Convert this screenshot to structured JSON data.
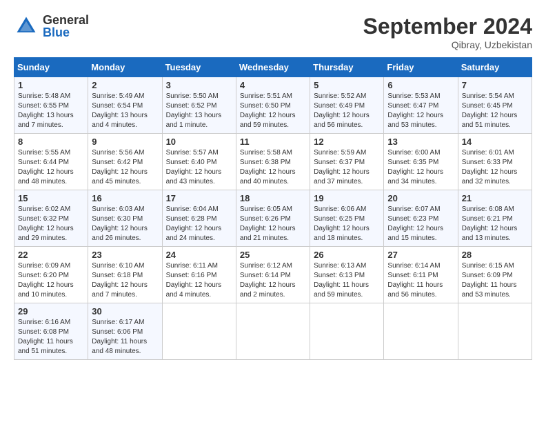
{
  "header": {
    "logo_general": "General",
    "logo_blue": "Blue",
    "month_title": "September 2024",
    "location": "Qibray, Uzbekistan"
  },
  "days_of_week": [
    "Sunday",
    "Monday",
    "Tuesday",
    "Wednesday",
    "Thursday",
    "Friday",
    "Saturday"
  ],
  "weeks": [
    [
      {
        "day": "1",
        "info": "Sunrise: 5:48 AM\nSunset: 6:55 PM\nDaylight: 13 hours\nand 7 minutes."
      },
      {
        "day": "2",
        "info": "Sunrise: 5:49 AM\nSunset: 6:54 PM\nDaylight: 13 hours\nand 4 minutes."
      },
      {
        "day": "3",
        "info": "Sunrise: 5:50 AM\nSunset: 6:52 PM\nDaylight: 13 hours\nand 1 minute."
      },
      {
        "day": "4",
        "info": "Sunrise: 5:51 AM\nSunset: 6:50 PM\nDaylight: 12 hours\nand 59 minutes."
      },
      {
        "day": "5",
        "info": "Sunrise: 5:52 AM\nSunset: 6:49 PM\nDaylight: 12 hours\nand 56 minutes."
      },
      {
        "day": "6",
        "info": "Sunrise: 5:53 AM\nSunset: 6:47 PM\nDaylight: 12 hours\nand 53 minutes."
      },
      {
        "day": "7",
        "info": "Sunrise: 5:54 AM\nSunset: 6:45 PM\nDaylight: 12 hours\nand 51 minutes."
      }
    ],
    [
      {
        "day": "8",
        "info": "Sunrise: 5:55 AM\nSunset: 6:44 PM\nDaylight: 12 hours\nand 48 minutes."
      },
      {
        "day": "9",
        "info": "Sunrise: 5:56 AM\nSunset: 6:42 PM\nDaylight: 12 hours\nand 45 minutes."
      },
      {
        "day": "10",
        "info": "Sunrise: 5:57 AM\nSunset: 6:40 PM\nDaylight: 12 hours\nand 43 minutes."
      },
      {
        "day": "11",
        "info": "Sunrise: 5:58 AM\nSunset: 6:38 PM\nDaylight: 12 hours\nand 40 minutes."
      },
      {
        "day": "12",
        "info": "Sunrise: 5:59 AM\nSunset: 6:37 PM\nDaylight: 12 hours\nand 37 minutes."
      },
      {
        "day": "13",
        "info": "Sunrise: 6:00 AM\nSunset: 6:35 PM\nDaylight: 12 hours\nand 34 minutes."
      },
      {
        "day": "14",
        "info": "Sunrise: 6:01 AM\nSunset: 6:33 PM\nDaylight: 12 hours\nand 32 minutes."
      }
    ],
    [
      {
        "day": "15",
        "info": "Sunrise: 6:02 AM\nSunset: 6:32 PM\nDaylight: 12 hours\nand 29 minutes."
      },
      {
        "day": "16",
        "info": "Sunrise: 6:03 AM\nSunset: 6:30 PM\nDaylight: 12 hours\nand 26 minutes."
      },
      {
        "day": "17",
        "info": "Sunrise: 6:04 AM\nSunset: 6:28 PM\nDaylight: 12 hours\nand 24 minutes."
      },
      {
        "day": "18",
        "info": "Sunrise: 6:05 AM\nSunset: 6:26 PM\nDaylight: 12 hours\nand 21 minutes."
      },
      {
        "day": "19",
        "info": "Sunrise: 6:06 AM\nSunset: 6:25 PM\nDaylight: 12 hours\nand 18 minutes."
      },
      {
        "day": "20",
        "info": "Sunrise: 6:07 AM\nSunset: 6:23 PM\nDaylight: 12 hours\nand 15 minutes."
      },
      {
        "day": "21",
        "info": "Sunrise: 6:08 AM\nSunset: 6:21 PM\nDaylight: 12 hours\nand 13 minutes."
      }
    ],
    [
      {
        "day": "22",
        "info": "Sunrise: 6:09 AM\nSunset: 6:20 PM\nDaylight: 12 hours\nand 10 minutes."
      },
      {
        "day": "23",
        "info": "Sunrise: 6:10 AM\nSunset: 6:18 PM\nDaylight: 12 hours\nand 7 minutes."
      },
      {
        "day": "24",
        "info": "Sunrise: 6:11 AM\nSunset: 6:16 PM\nDaylight: 12 hours\nand 4 minutes."
      },
      {
        "day": "25",
        "info": "Sunrise: 6:12 AM\nSunset: 6:14 PM\nDaylight: 12 hours\nand 2 minutes."
      },
      {
        "day": "26",
        "info": "Sunrise: 6:13 AM\nSunset: 6:13 PM\nDaylight: 11 hours\nand 59 minutes."
      },
      {
        "day": "27",
        "info": "Sunrise: 6:14 AM\nSunset: 6:11 PM\nDaylight: 11 hours\nand 56 minutes."
      },
      {
        "day": "28",
        "info": "Sunrise: 6:15 AM\nSunset: 6:09 PM\nDaylight: 11 hours\nand 53 minutes."
      }
    ],
    [
      {
        "day": "29",
        "info": "Sunrise: 6:16 AM\nSunset: 6:08 PM\nDaylight: 11 hours\nand 51 minutes."
      },
      {
        "day": "30",
        "info": "Sunrise: 6:17 AM\nSunset: 6:06 PM\nDaylight: 11 hours\nand 48 minutes."
      },
      {
        "day": "",
        "info": ""
      },
      {
        "day": "",
        "info": ""
      },
      {
        "day": "",
        "info": ""
      },
      {
        "day": "",
        "info": ""
      },
      {
        "day": "",
        "info": ""
      }
    ]
  ]
}
